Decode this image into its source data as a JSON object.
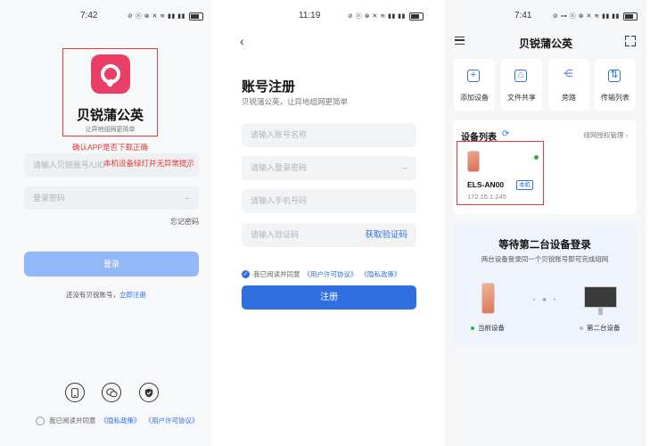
{
  "panel1": {
    "status": {
      "time": "7:42",
      "icons": "⊘ ⓝ ⊗ ✕ ≋ ▮▮ ▮▮"
    },
    "app_name": "贝锐蒲公英",
    "app_subtitle": "让异地组网更简单",
    "annotation": "确认APP是否下载正确",
    "account_placeholder": "请输入贝锐账号/UID",
    "password_placeholder": "登录密码",
    "forgot_password": "忘记密码",
    "login_button": "登录",
    "no_account_text": "还没有贝锐账号，",
    "register_link": "立即注册",
    "social_icons": [
      "phone-icon",
      "wechat-icon",
      "shield-icon"
    ],
    "agreement_prefix": "我已阅读并同意",
    "privacy_link": "《隐私政策》",
    "license_link": "《用户许可协议》"
  },
  "panel2": {
    "status": {
      "time": "11:19",
      "icons": "⊘ ⓝ ⊗ ✕ ≋ ▮▮ ▮▮"
    },
    "back": "‹",
    "title": "账号注册",
    "subtitle": "贝锐蒲公英，让异地组网更简单",
    "fields": {
      "account": "请输入账号名称",
      "password": "请输入登录密码",
      "phone": "请输入手机号码",
      "code": "请输入验证码"
    },
    "get_code": "获取验证码",
    "agreement_prefix": "我已阅读并同意",
    "license_link": "《用户许可协议》",
    "privacy_link": "《隐私政策》",
    "register_button": "注册"
  },
  "panel3": {
    "status": {
      "time": "7:41",
      "icons": "⊘ ⊶ ⓝ ⊗ ✕ ≋ ▮▮ ▮▮"
    },
    "title": "贝锐蒲公英",
    "tiles": [
      {
        "label": "添加设备",
        "icon": "add-device-icon",
        "glyph": "+"
      },
      {
        "label": "文件共享",
        "icon": "folder-share-icon",
        "glyph": "⌂"
      },
      {
        "label": "旁路",
        "icon": "bypass-icon",
        "glyph": "⋲"
      },
      {
        "label": "传输列表",
        "icon": "transfer-list-icon",
        "glyph": "⇅"
      }
    ],
    "device_list_title": "设备列表",
    "authorization_link": "组网授权管理 ›",
    "device": {
      "name": "ELS-AN00",
      "badge": "本机",
      "ip": "172.16.1.245",
      "online": true
    },
    "annotation": "本机设备绿灯并无异常提示",
    "wait": {
      "title": "等待第二台设备登录",
      "subtitle": "两台设备登录同一个贝锐账号即可完成组网",
      "current_device": "当前设备",
      "second_device": "第二台设备"
    },
    "colors": {
      "online": "#2eaa46",
      "offline": "#bbbbbb",
      "accent": "#2f6fe0"
    }
  }
}
